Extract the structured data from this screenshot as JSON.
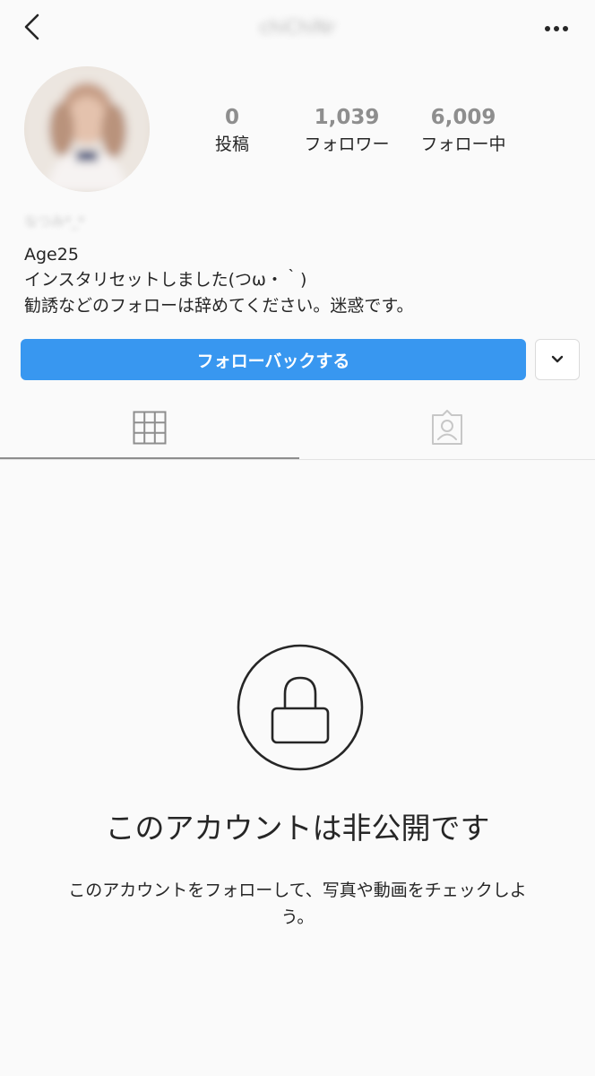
{
  "header": {
    "username": "chiChiNr",
    "back_icon": "chevron-left-icon",
    "more_icon": "ellipsis-icon"
  },
  "profile": {
    "avatar_icon": "profile-photo",
    "stats": [
      {
        "value": "0",
        "label": "投稿"
      },
      {
        "value": "1,039",
        "label": "フォロワー"
      },
      {
        "value": "6,009",
        "label": "フォロー中"
      }
    ],
    "display_name": "なつみ*_*",
    "bio_lines": [
      "Age25",
      "インスタリセットしました(つω・｀)",
      "勧誘などのフォローは辞めてください。迷惑です。"
    ]
  },
  "actions": {
    "follow_back_label": "フォローバックする",
    "dropdown_icon": "chevron-down-icon"
  },
  "tabs": [
    {
      "icon": "grid-icon",
      "active": true
    },
    {
      "icon": "tagged-icon",
      "active": false
    }
  ],
  "private": {
    "lock_icon": "lock-icon",
    "title": "このアカウントは非公開です",
    "description": "このアカウントをフォローして、写真や動画をチェックしよう。"
  },
  "colors": {
    "accent": "#3897f0",
    "text": "#262626",
    "muted": "#8e8e8e",
    "background": "#fafafa"
  }
}
